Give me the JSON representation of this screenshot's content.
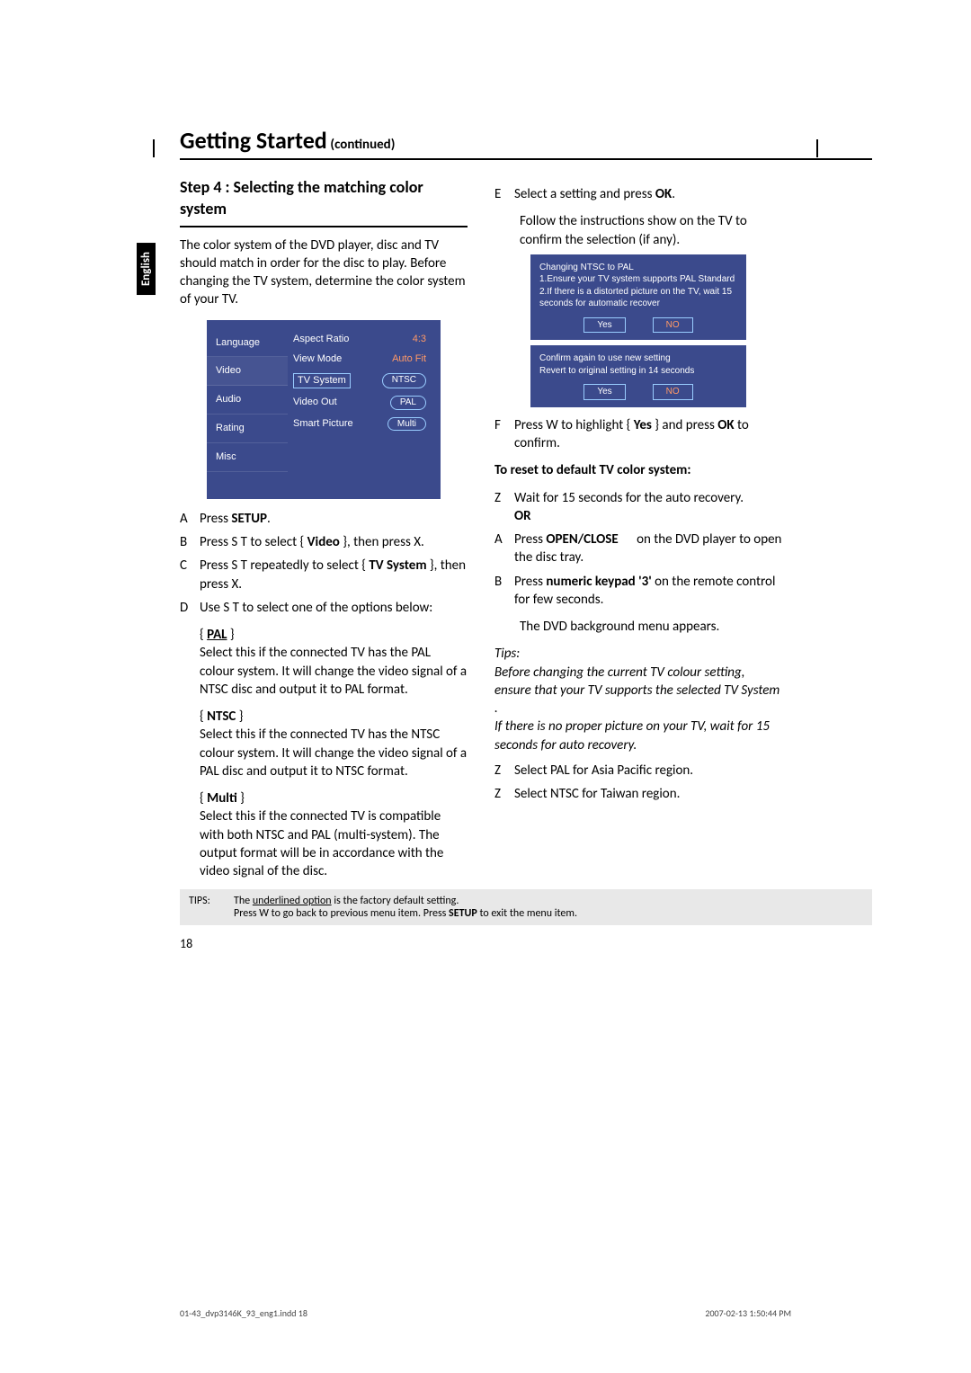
{
  "header": {
    "title": "Getting Started",
    "continued": "(continued)"
  },
  "language_tab": "English",
  "left": {
    "step_title": "Step 4 : Selecting the matching color system",
    "intro": "The color system of the DVD player, disc and TV should match in order for the disc to play. Before changing the TV system, determine the color system of your TV.",
    "osd": {
      "menu": [
        "Language",
        "Video",
        "Audio",
        "Rating",
        "Misc"
      ],
      "rows": [
        {
          "k": "Aspect Ratio",
          "v": "4:3"
        },
        {
          "k": "View Mode",
          "v": "Auto Fit"
        },
        {
          "k": "TV System",
          "v": "NTSC",
          "selected": true
        },
        {
          "k": "Video Out",
          "v": "PAL",
          "pill": true
        },
        {
          "k": "Smart Picture",
          "v": "Multi",
          "pill": true
        }
      ]
    },
    "steps": [
      {
        "mk": "A",
        "html": "Press <b>SETUP</b>."
      },
      {
        "mk": "B",
        "html": "Press  S  T  to select { <b>Video</b> }, then press  X."
      },
      {
        "mk": "C",
        "html": "Press  S  T  repeatedly to select { <b>TV System</b> }, then press  X."
      },
      {
        "mk": "D",
        "html": "Use  S  T  to select one of the options below:"
      }
    ],
    "options": [
      {
        "title": "PAL",
        "underline": true,
        "body": "Select this if the connected TV has the PAL colour system. It will change the video signal of a NTSC disc and output it to PAL format."
      },
      {
        "title": "NTSC",
        "underline": false,
        "body": "Select this if the connected TV has the NTSC colour system. It will change the video signal of a PAL disc and output it to NTSC format."
      },
      {
        "title": "Multi",
        "underline": false,
        "body": "Select this if the connected TV is compatible with both NTSC and PAL (multi-system). The output format will be in accordance with the video signal of the disc."
      }
    ]
  },
  "right": {
    "e_line": "Select a setting and press <b>OK</b>.",
    "e_sub": "Follow the instructions show on the TV to confirm the selection (if any).",
    "box1_lines": [
      "Changing NTSC to PAL",
      "1.Ensure your TV system supports PAL Standard",
      "2.If there is a distorted picture on the TV, wait 15 seconds for automatic recover"
    ],
    "box1_yes": "Yes",
    "box1_no": "NO",
    "box2_lines": [
      "Confirm again to use new setting",
      "Revert to original setting in 14 seconds"
    ],
    "box2_yes": "Yes",
    "box2_no": "NO",
    "f_line": "Press  W to highlight { <b>Yes</b> } and press <b>OK</b> to confirm.",
    "reset_head": "To reset to default TV color system:",
    "reset_steps": [
      {
        "mk": "Z",
        "html": "Wait for 15 seconds for the auto recovery.<br><b>OR</b>"
      },
      {
        "mk": "A",
        "html": "Press <b>OPEN/CLOSE</b> &nbsp;&nbsp;&nbsp;&nbsp; on the DVD player to open the disc tray."
      },
      {
        "mk": "B",
        "html": "Press <b>numeric keypad '3'</b> on the remote control for few seconds."
      }
    ],
    "reset_sub": "The DVD background menu appears.",
    "tips_label": "Tips:",
    "tips_body": "Before changing the current TV colour setting, ensure that your TV supports the selected TV System .\n If there is no proper picture on your TV, wait for 15 seconds for auto recovery.",
    "region_notes": [
      {
        "mk": "Z",
        "t": "Select PAL for Asia Pacific region."
      },
      {
        "mk": "Z",
        "t": "Select NTSC for Taiwan region."
      }
    ]
  },
  "tips_footer": {
    "label": "TIPS:",
    "line1": "The <u>underlined option</u> is the factory default setting.",
    "line2": "Press  W to go back to previous menu item. Press <b>SETUP</b> to exit the menu item."
  },
  "page_number": "18",
  "print_footer": {
    "left": "01-43_dvp3146K_93_eng1.indd   18",
    "right": "2007-02-13   1:50:44 PM"
  }
}
